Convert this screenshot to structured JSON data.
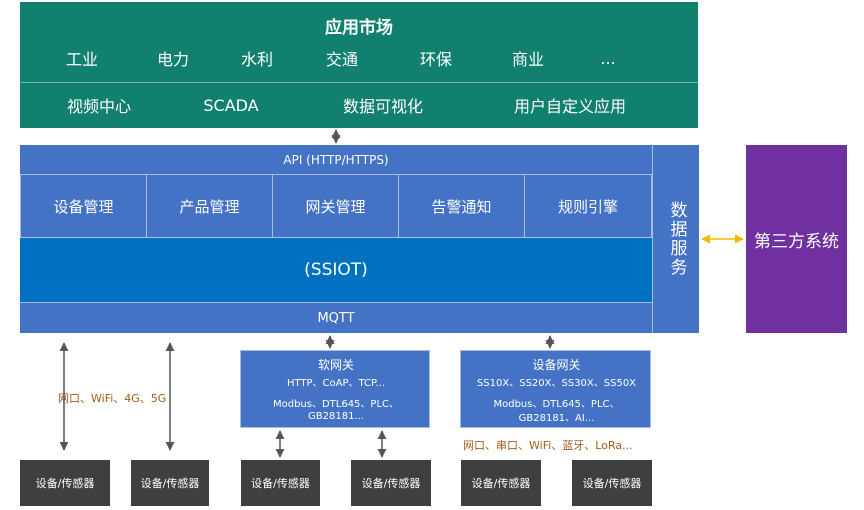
{
  "app_market": {
    "title": "应用市场",
    "industries": [
      "工业",
      "电力",
      "水利",
      "交通",
      "环保",
      "商业",
      "..."
    ],
    "apps": [
      "视频中心",
      "SCADA",
      "数据可视化",
      "用户自定义应用"
    ]
  },
  "platform": {
    "api": "API (HTTP/HTTPS)",
    "modules": [
      "设备管理",
      "产品管理",
      "网关管理",
      "告警通知",
      "规则引擎"
    ],
    "core": "(SSIOT)",
    "mqtt": "MQTT",
    "data_service": "数据服务"
  },
  "third_party": "第三方系统",
  "soft_gateway": {
    "title": "软网关",
    "line1": "HTTP、CoAP、TCP...",
    "line2": "Modbus、DTL645、PLC、",
    "line3": "GB28181..."
  },
  "device_gateway": {
    "title": "设备网关",
    "line1": "SS10X、SS20X、SS30X、SS50X",
    "line2": "Modbus、DTL645、PLC、",
    "line3": "GB28181、AI..."
  },
  "protocols": {
    "left": "网口、WiFi、4G、5G",
    "right": "网口、串口、WiFi、蓝牙、LoRa..."
  },
  "devices": [
    "设备/传感器",
    "设备/传感器",
    "设备/传感器",
    "设备/传感器",
    "设备/传感器",
    "设备/传感器"
  ],
  "colors": {
    "app_market": "#12806e",
    "platform": "#4472c4",
    "core": "#0070c0",
    "third_party": "#7030a0",
    "device": "#3f3f3f",
    "protocol_text": "#a55a1b",
    "double_arrow": "#f5b800"
  }
}
